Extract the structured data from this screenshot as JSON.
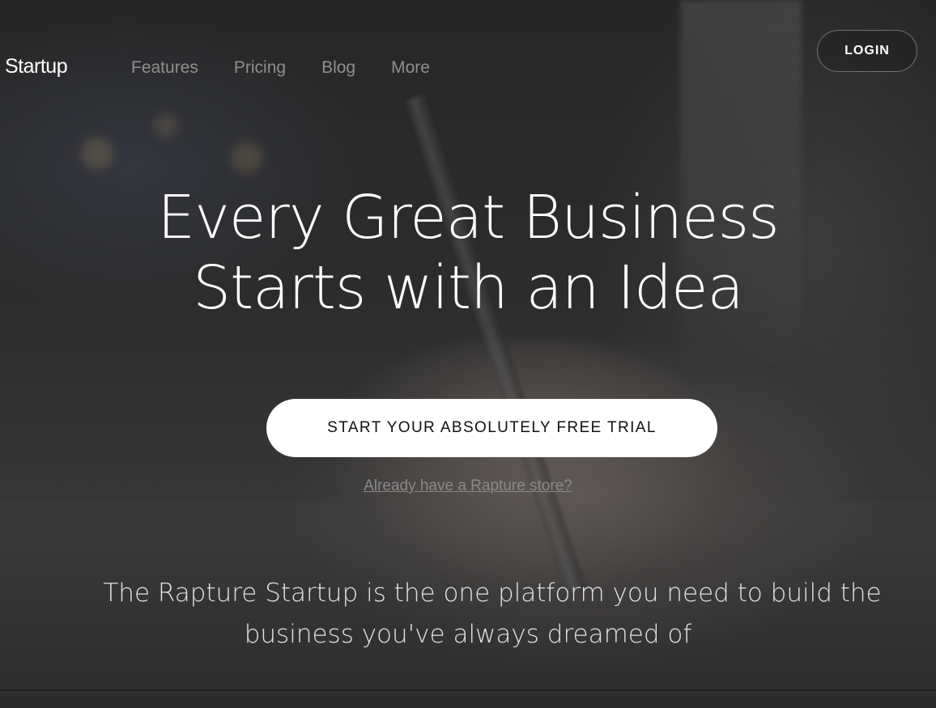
{
  "header": {
    "brand": "Startup",
    "nav": [
      {
        "label": "Features"
      },
      {
        "label": "Pricing"
      },
      {
        "label": "Blog"
      },
      {
        "label": "More"
      }
    ],
    "login_label": "LOGIN"
  },
  "hero": {
    "headline_line1": "Every Great Business",
    "headline_line2": "Starts with an Idea",
    "cta_label": "START YOUR ABSOLUTELY FREE TRIAL",
    "store_link": "Already have a Rapture store?",
    "tagline_line1": "The Rapture Startup is the one platform you need to build the",
    "tagline_line2": "business you've always dreamed of"
  },
  "colors": {
    "background": "#2a2a2a",
    "text": "#ffffff",
    "nav_text": "#8f8f8f",
    "cta_background": "#ffffff",
    "cta_text": "#111111"
  }
}
